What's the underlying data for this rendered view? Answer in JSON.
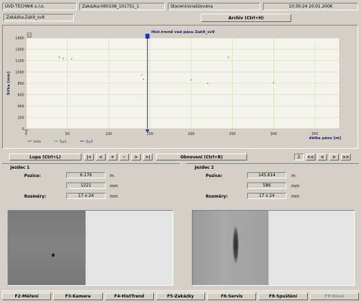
{
  "header": {
    "company": "UVD TECHNIK s.r.o.",
    "order": "Zakázka:060108_101751_1",
    "status": "Staceninicializována",
    "datetime": "10:30:24 20.01.2006",
    "order_field": "Zakázka:Zak9_sv9",
    "archive_button": "Archiv (Ctrl+H)"
  },
  "chart": {
    "marker_label": "1"
  },
  "chart_data": {
    "type": "scatter",
    "title": "Hist.trend vad pásu  Zak9_sv9",
    "ylabel": "Šířka [mm]",
    "xlabel": "délka pásu [m]",
    "xlim": [
      0,
      380
    ],
    "ylim": [
      0,
      1600
    ],
    "xticks": [
      0,
      50,
      100,
      150,
      200,
      250,
      300,
      350
    ],
    "yticks": [
      0,
      200,
      400,
      600,
      800,
      1000,
      1200,
      1400,
      1600
    ],
    "cursor_x": 147,
    "series": [
      {
        "name": "Vada",
        "color": "#c04040",
        "points": []
      },
      {
        "name": "Typ2",
        "color": "#40a0a0",
        "points": [
          [
            40,
            1260
          ],
          [
            45,
            1240
          ],
          [
            55,
            1230
          ],
          [
            140,
            950
          ],
          [
            142,
            870
          ],
          [
            200,
            860
          ],
          [
            220,
            800
          ],
          [
            245,
            1260
          ],
          [
            300,
            810
          ]
        ]
      },
      {
        "name": "Typ3",
        "color": "#4040c0",
        "points": []
      }
    ]
  },
  "controls": {
    "zoom_button": "Lupa (Ctrl+L)",
    "nav": [
      "|<",
      "<",
      "+",
      "-",
      ">",
      ">|"
    ],
    "refresh_button": "Obnovení (Ctrl+R)",
    "page_value": "2",
    "nav2": [
      "<<",
      "<",
      ">",
      ">>"
    ]
  },
  "rider1": {
    "title": "Jezdec 1",
    "position_label": "Pozice:",
    "position_value": "6.176",
    "position_unit": "m",
    "position_mm": "1221",
    "mm_unit": "mm",
    "size_label": "Rozměry:",
    "size_value": "17 x 24",
    "size_unit": "mm"
  },
  "rider2": {
    "title": "Jezdec 2",
    "position_label": "Pozice:",
    "position_value": "145.614",
    "position_unit": "m",
    "position_mm": "586",
    "mm_unit": "mm",
    "size_label": "Rozměry:",
    "size_value": "17 x 24",
    "size_unit": "mm"
  },
  "fkeys": [
    "F2-Měření",
    "F3-Kamera",
    "F4-HistTrend",
    "F5-Zakázky",
    "F6-Servis",
    "F8-Spuštění",
    "F9-Nová"
  ]
}
